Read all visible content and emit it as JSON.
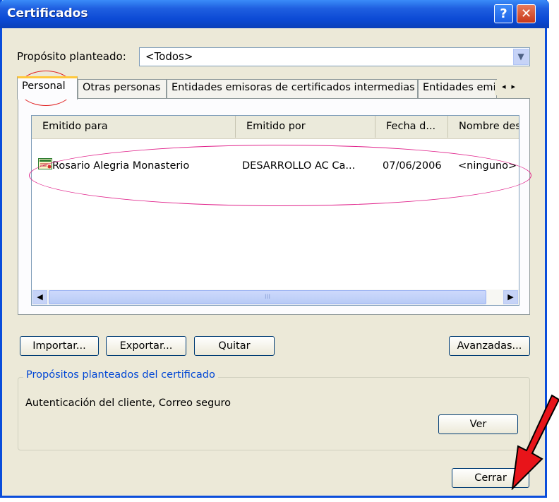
{
  "window": {
    "title": "Certificados",
    "help_glyph": "?",
    "close_glyph": "✕"
  },
  "purpose": {
    "label": "Propósito planteado:",
    "value": "<Todos>"
  },
  "tabs": [
    {
      "label": "Personal"
    },
    {
      "label": "Otras personas"
    },
    {
      "label": "Entidades emisoras de certificados intermedias"
    },
    {
      "label": "Entidades emi"
    }
  ],
  "tab_scroll": {
    "left": "◂",
    "right": "▸"
  },
  "list": {
    "columns": [
      "Emitido para",
      "Emitido por",
      "Fecha d...",
      "Nombre des"
    ],
    "rows": [
      {
        "issued_to": "Rosario Alegria Monasterio",
        "issued_by": "DESARROLLO AC Ca...",
        "date": "07/06/2006",
        "friendly_name": "<ninguno>"
      }
    ],
    "scroll_grip": "III"
  },
  "buttons": {
    "import": "Importar...",
    "export": "Exportar...",
    "remove": "Quitar",
    "advanced": "Avanzadas...",
    "view": "Ver",
    "close": "Cerrar"
  },
  "purposes_group": {
    "title": "Propósitos planteados del certificado",
    "text": "Autenticación del cliente, Correo seguro"
  },
  "colors": {
    "titlebar": "#0b49d4",
    "dialog_bg": "#ece9d8",
    "annotation_magenta": "#e0218a",
    "annotation_arrow": "#e8141a"
  }
}
